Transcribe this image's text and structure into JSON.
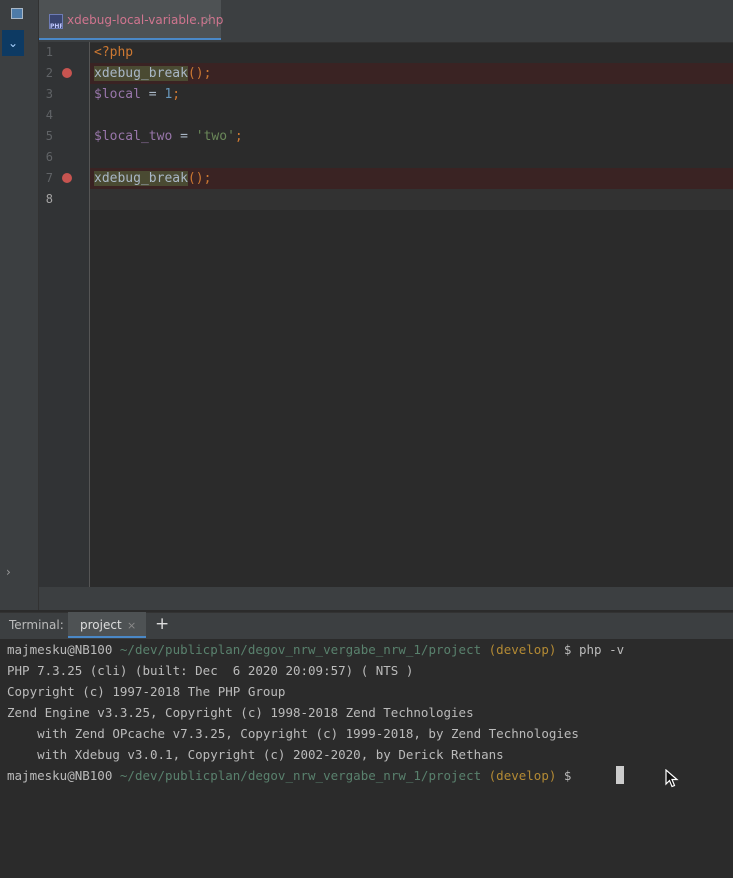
{
  "sidebar": {
    "project_label": "P",
    "collapse_icon": "chevron-down-icon",
    "expand_icon": "chevron-right-icon"
  },
  "editor": {
    "tab": {
      "filename": "xdebug-local-variable.php",
      "icon_text": "PHP",
      "close_glyph": "×"
    },
    "lines": [
      {
        "num": "1",
        "breakpoint": false,
        "tokens": [
          {
            "t": "<?php",
            "c": "kw"
          }
        ]
      },
      {
        "num": "2",
        "breakpoint": true,
        "tokens": [
          {
            "t": "xdebug_break",
            "c": "fn-hl"
          },
          {
            "t": "();",
            "c": "punc"
          }
        ]
      },
      {
        "num": "3",
        "breakpoint": false,
        "tokens": [
          {
            "t": "$local",
            "c": "var"
          },
          {
            "t": " = ",
            "c": ""
          },
          {
            "t": "1",
            "c": "num"
          },
          {
            "t": ";",
            "c": "punc"
          }
        ]
      },
      {
        "num": "4",
        "breakpoint": false,
        "tokens": []
      },
      {
        "num": "5",
        "breakpoint": false,
        "tokens": [
          {
            "t": "$local_two",
            "c": "var"
          },
          {
            "t": " = ",
            "c": ""
          },
          {
            "t": "'two'",
            "c": "str"
          },
          {
            "t": ";",
            "c": "punc"
          }
        ]
      },
      {
        "num": "6",
        "breakpoint": false,
        "tokens": []
      },
      {
        "num": "7",
        "breakpoint": true,
        "tokens": [
          {
            "t": "xdebug_break",
            "c": "fn-hl"
          },
          {
            "t": "();",
            "c": "punc"
          }
        ]
      },
      {
        "num": "8",
        "breakpoint": false,
        "tokens": []
      }
    ]
  },
  "terminal": {
    "title": "Terminal:",
    "tab_label": "project",
    "tab_close": "×",
    "add_label": "+",
    "prompt": {
      "user": "majmesku@NB100",
      "path": "~/dev/publicplan/degov_nrw_vergabe_nrw_1/project",
      "branch": "(develop)",
      "symbol": "$"
    },
    "command": "php -v",
    "output": [
      "PHP 7.3.25 (cli) (built: Dec  6 2020 20:09:57) ( NTS )",
      "Copyright (c) 1997-2018 The PHP Group",
      "Zend Engine v3.3.25, Copyright (c) 1998-2018 Zend Technologies",
      "    with Zend OPcache v7.3.25, Copyright (c) 1999-2018, by Zend Technologies",
      "    with Xdebug v3.0.1, Copyright (c) 2002-2020, by Derick Rethans"
    ]
  },
  "colors": {
    "keyword": "#cc7832",
    "variable": "#9876aa",
    "number": "#6897bb",
    "string": "#6a8759",
    "breakpoint": "#c75450",
    "accent": "#4a88c7"
  }
}
